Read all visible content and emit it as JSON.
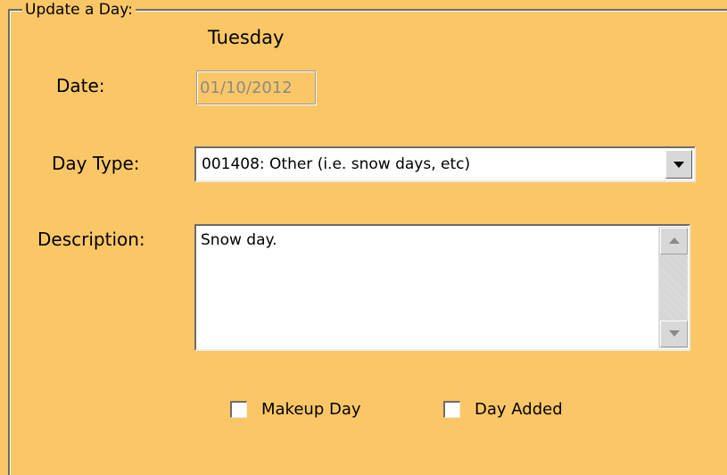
{
  "group": {
    "title": "Update a Day:"
  },
  "day_name": "Tuesday",
  "fields": {
    "date_label": "Date:",
    "date_value": "01/10/2012",
    "day_type_label": "Day Type:",
    "day_type_value": "001408: Other (i.e. snow days, etc)",
    "description_label": "Description:",
    "description_value": "Snow day."
  },
  "checkboxes": {
    "makeup_day_label": "Makeup Day",
    "makeup_day_checked": false,
    "day_added_label": "Day Added",
    "day_added_checked": false
  },
  "colors": {
    "background": "#fbc766",
    "border_dark": "#6b6b6b",
    "disabled_text": "#8a8a8a"
  }
}
